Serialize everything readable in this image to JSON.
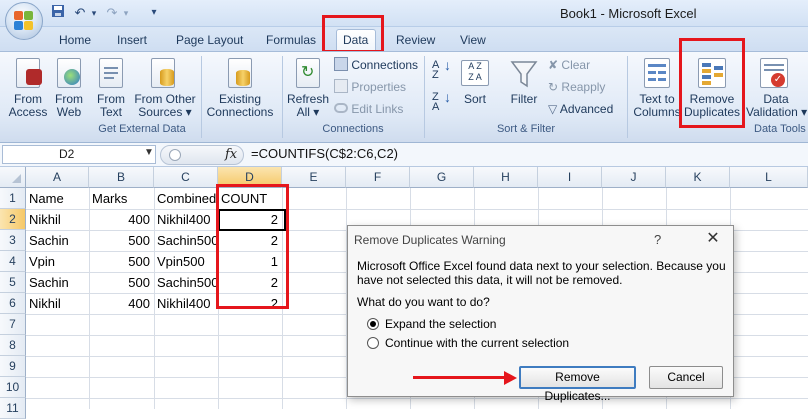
{
  "window": {
    "title": "Book1 - Microsoft Excel"
  },
  "quick_access": {
    "save_icon": "save-icon",
    "undo_icon": "undo-icon",
    "redo_icon": "redo-icon",
    "customize_icon": "dropdown-icon"
  },
  "tabs": [
    "Home",
    "Insert",
    "Page Layout",
    "Formulas",
    "Data",
    "Review",
    "View"
  ],
  "active_tab": "Data",
  "ribbon": {
    "get_external_data": {
      "label": "Get External Data",
      "from_access": [
        "From",
        "Access"
      ],
      "from_web": [
        "From",
        "Web"
      ],
      "from_text": [
        "From",
        "Text"
      ],
      "from_other": [
        "From Other",
        "Sources ▾"
      ],
      "existing": [
        "Existing",
        "Connections"
      ]
    },
    "connections": {
      "label": "Connections",
      "refresh": [
        "Refresh",
        "All ▾"
      ],
      "connections": "Connections",
      "properties": "Properties",
      "edit_links": "Edit Links"
    },
    "sort_filter": {
      "label": "Sort & Filter",
      "sort": "Sort",
      "filter": "Filter",
      "clear": "Clear",
      "reapply": "Reapply",
      "advanced": "Advanced"
    },
    "data_tools": {
      "label": "Data Tools",
      "text_to_columns": [
        "Text to",
        "Columns"
      ],
      "remove_duplicates": [
        "Remove",
        "Duplicates"
      ],
      "data_validation": [
        "Data",
        "Validation ▾"
      ]
    }
  },
  "formula_bar": {
    "name_box": "D2",
    "fx": "fx",
    "formula": "=COUNTIFS(C$2:C6,C2)"
  },
  "grid": {
    "columns": [
      "A",
      "B",
      "C",
      "D",
      "E",
      "F",
      "G",
      "H",
      "I",
      "J",
      "K",
      "L"
    ],
    "rows": [
      "1",
      "2",
      "3",
      "4",
      "5",
      "6",
      "7",
      "8",
      "9",
      "10",
      "11"
    ],
    "headers": [
      "Name",
      "Marks",
      "Combined",
      "COUNT"
    ],
    "data": [
      [
        "Nikhil",
        "400",
        "Nikhil400",
        "2"
      ],
      [
        "Sachin",
        "500",
        "Sachin500",
        "2"
      ],
      [
        "Vpin",
        "500",
        "Vpin500",
        "1"
      ],
      [
        "Sachin",
        "500",
        "Sachin500",
        "2"
      ],
      [
        "Nikhil",
        "400",
        "Nikhil400",
        "2"
      ]
    ]
  },
  "dialog": {
    "title": "Remove Duplicates Warning",
    "help": "?",
    "close": "✕",
    "message": "Microsoft Office Excel found data next to your selection. Because you have not selected this data, it will not be removed.",
    "question": "What do you want to do?",
    "option_expand": "Expand the selection",
    "option_continue": "Continue with the current selection",
    "selected_option": "expand",
    "remove_button": "Remove Duplicates...",
    "cancel_button": "Cancel"
  },
  "colors": {
    "highlight": "#e5161c",
    "ribbon": "#dfe9f6",
    "focus": "#3f7cc0"
  }
}
